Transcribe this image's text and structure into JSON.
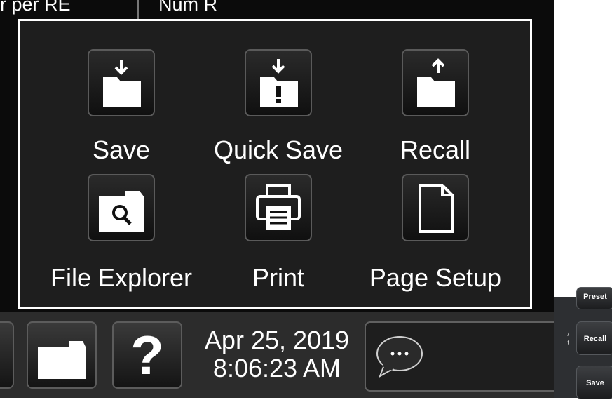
{
  "background_header": {
    "left_text": "r per RE",
    "right_text": "Num R"
  },
  "menu": {
    "items": [
      {
        "label": "Save",
        "icon": "folder-save-icon"
      },
      {
        "label": "Quick Save",
        "icon": "quick-save-icon"
      },
      {
        "label": "Recall",
        "icon": "folder-recall-icon"
      },
      {
        "label": "File Explorer",
        "icon": "folder-search-icon"
      },
      {
        "label": "Print",
        "icon": "printer-icon"
      },
      {
        "label": "Page Setup",
        "icon": "page-icon"
      }
    ]
  },
  "taskbar": {
    "folder_icon": "folder-icon",
    "help_icon": "question-mark-icon",
    "help_glyph": "?",
    "date": "Apr 25, 2019",
    "time": "8:06:23 AM",
    "chat_icon": "chat-bubble-icon"
  },
  "hardware": {
    "keys": [
      {
        "label": "Preset"
      },
      {
        "label": "Recall"
      },
      {
        "label": "Save"
      }
    ],
    "side_labels": [
      "/",
      "t"
    ]
  },
  "colors": {
    "screen": "#0b0b0b",
    "popup": "#1e1e1e",
    "border": "#ffffff",
    "taskbar": "#2c2c2c"
  }
}
